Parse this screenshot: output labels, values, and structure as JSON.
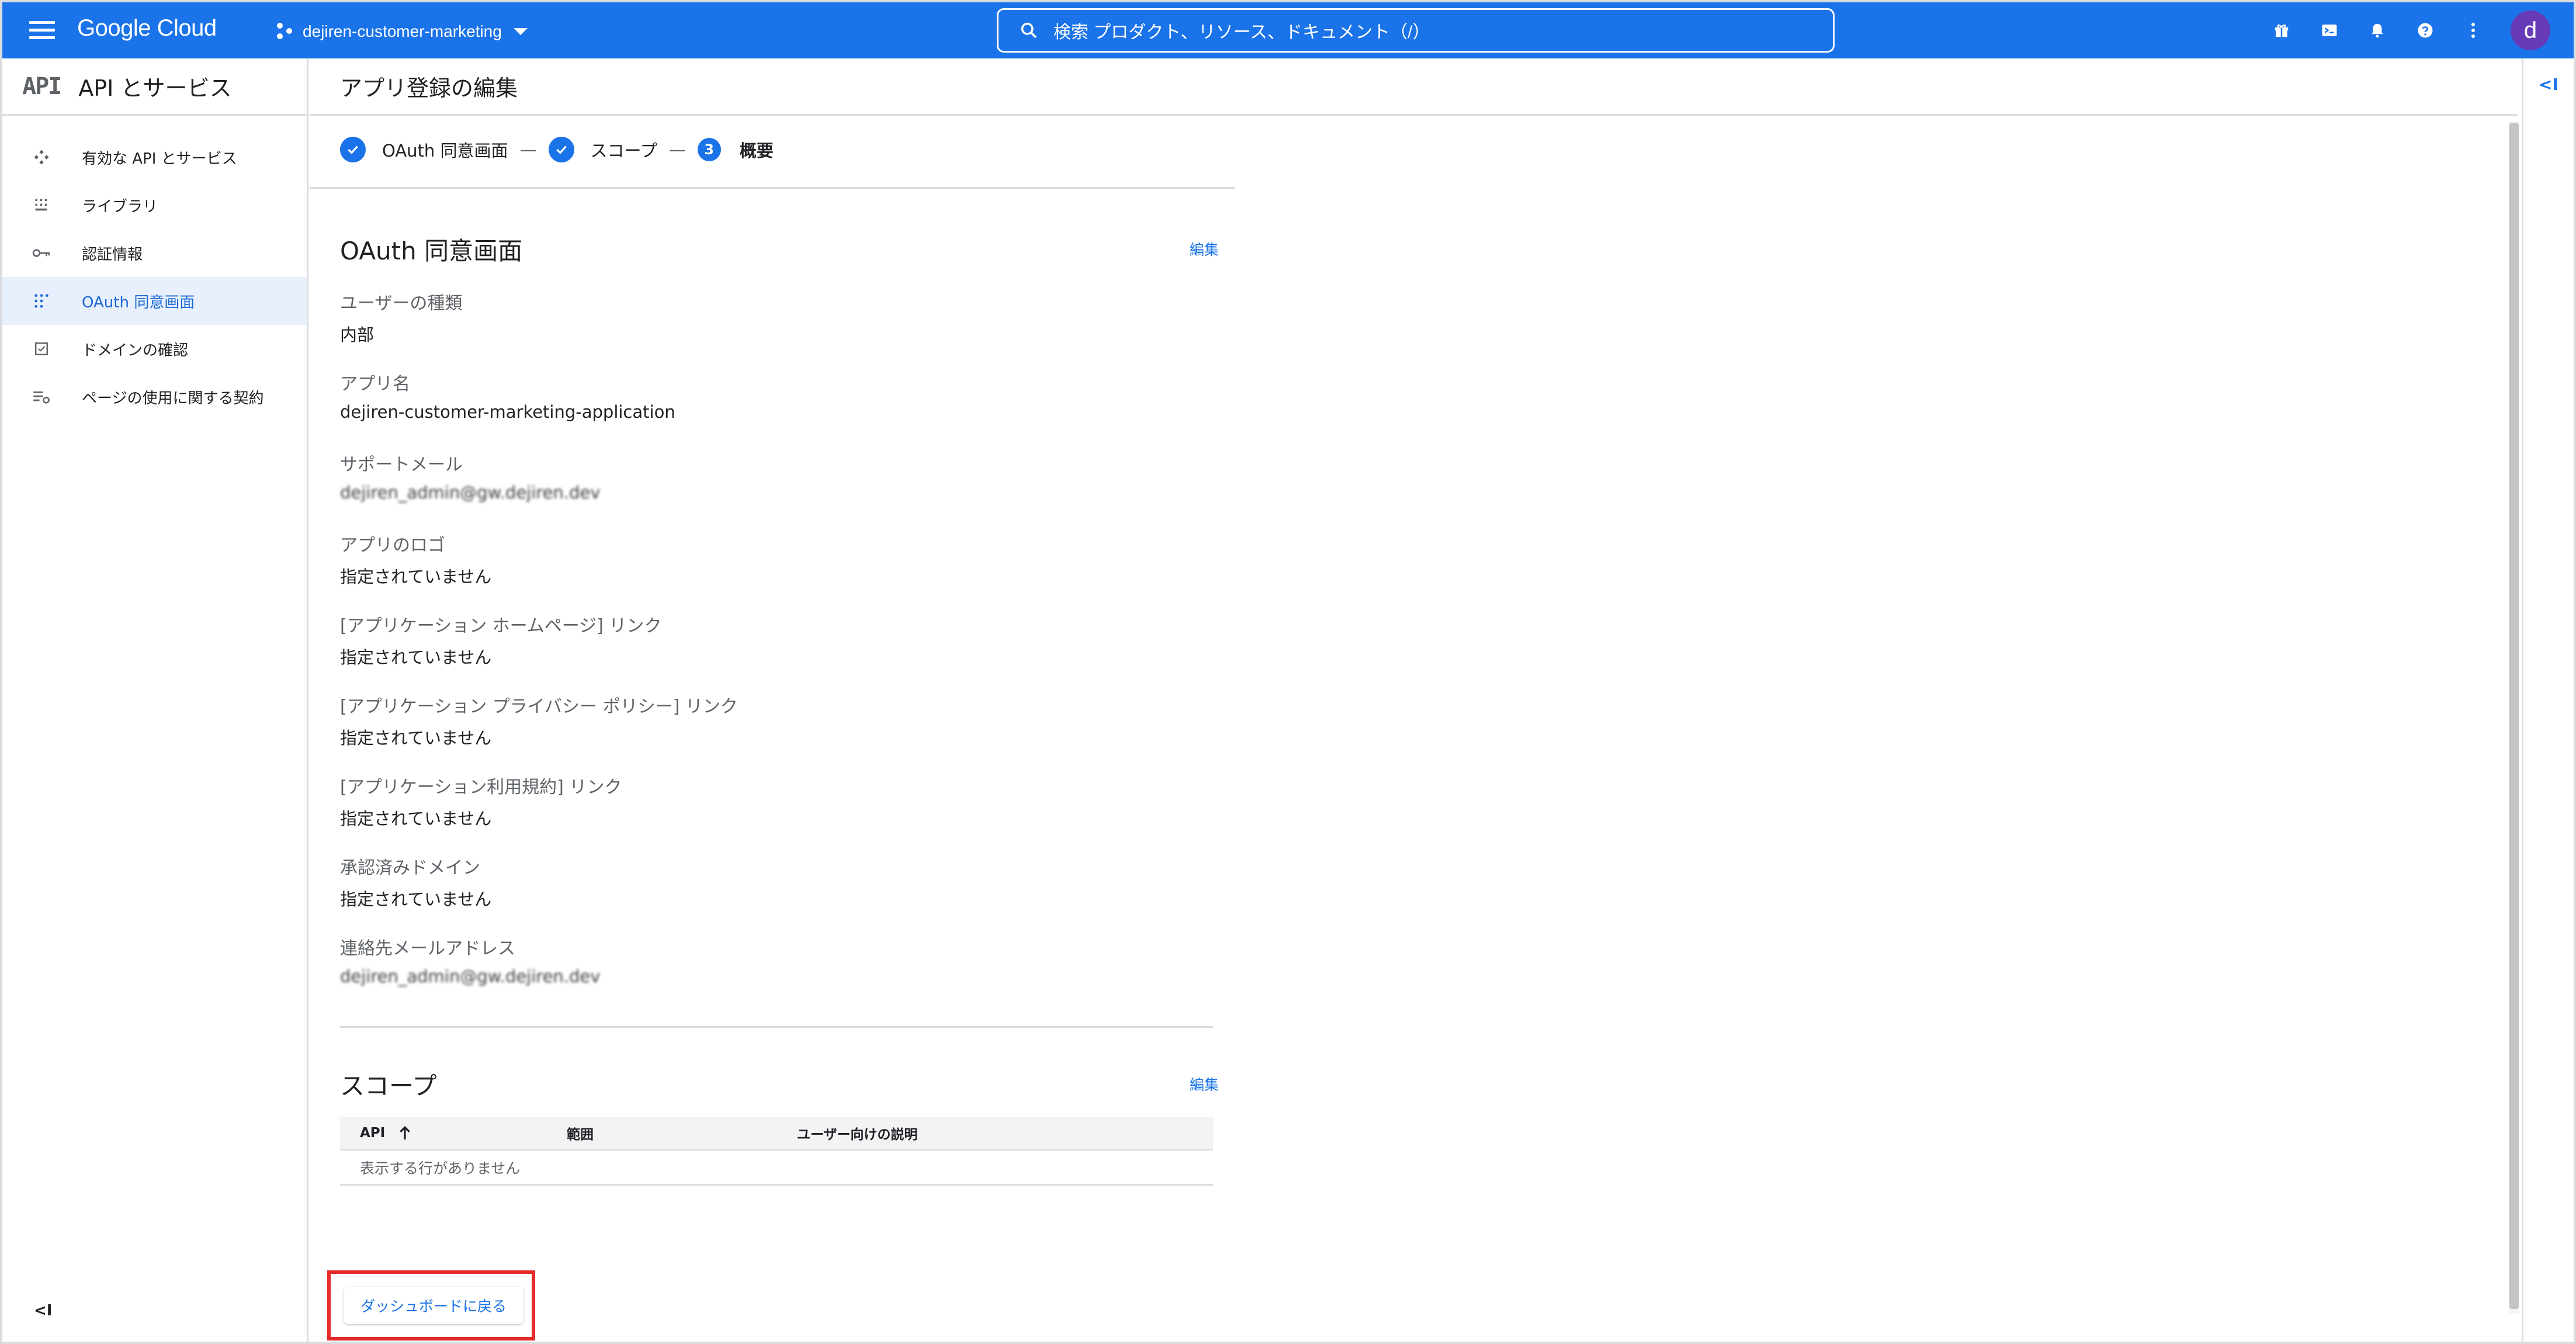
{
  "header": {
    "logo": "Google Cloud",
    "project": "dejiren-customer-marketing",
    "search_placeholder": "検索 プロダクト、リソース、ドキュメント（/）",
    "avatar": "d"
  },
  "sidebar": {
    "logo": "API",
    "title": "API とサービス",
    "items": [
      {
        "label": "有効な API とサービス",
        "icon": "api-hub-icon"
      },
      {
        "label": "ライブラリ",
        "icon": "library-icon"
      },
      {
        "label": "認証情報",
        "icon": "key-icon"
      },
      {
        "label": "OAuth 同意画面",
        "icon": "consent-icon"
      },
      {
        "label": "ドメインの確認",
        "icon": "domain-check-icon"
      },
      {
        "label": "ページの使用に関する契約",
        "icon": "page-settings-icon"
      }
    ],
    "collapse": "<I"
  },
  "page": {
    "title": "アプリ登録の編集",
    "steps": [
      {
        "label": "OAuth 同意画面",
        "state": "done"
      },
      {
        "label": "スコープ",
        "state": "done"
      },
      {
        "number": "3",
        "label": "概要",
        "state": "current"
      }
    ],
    "separator": "—"
  },
  "oauth": {
    "title": "OAuth 同意画面",
    "edit_label": "編集",
    "fields": [
      {
        "label": "ユーザーの種類",
        "value": "内部",
        "blurred": false
      },
      {
        "label": "アプリ名",
        "value": "dejiren-customer-marketing-application",
        "blurred": false
      },
      {
        "label": "サポートメール",
        "value": "dejiren_admin@gw.dejiren.dev",
        "blurred": true
      },
      {
        "label": "アプリのロゴ",
        "value": "指定されていません",
        "blurred": false
      },
      {
        "label": "[アプリケーション ホームページ] リンク",
        "value": "指定されていません",
        "blurred": false
      },
      {
        "label": "[アプリケーション プライバシー ポリシー] リンク",
        "value": "指定されていません",
        "blurred": false
      },
      {
        "label": "[アプリケーション利用規約] リンク",
        "value": "指定されていません",
        "blurred": false
      },
      {
        "label": "承認済みドメイン",
        "value": "指定されていません",
        "blurred": false
      },
      {
        "label": "連絡先メールアドレス",
        "value": "dejiren_admin@gw.dejiren.dev",
        "blurred": true
      }
    ]
  },
  "scopes": {
    "title": "スコープ",
    "edit_label": "編集",
    "columns": [
      "API",
      "範囲",
      "ユーザー向けの説明"
    ],
    "empty_text": "表示する行がありません"
  },
  "back_button": "ダッシュボードに戻る",
  "right_rail": {
    "toggle": "<I"
  },
  "colors": {
    "accent": "#1a73e8",
    "highlight_box": "#e52b2b",
    "avatar": "#673ab7"
  }
}
